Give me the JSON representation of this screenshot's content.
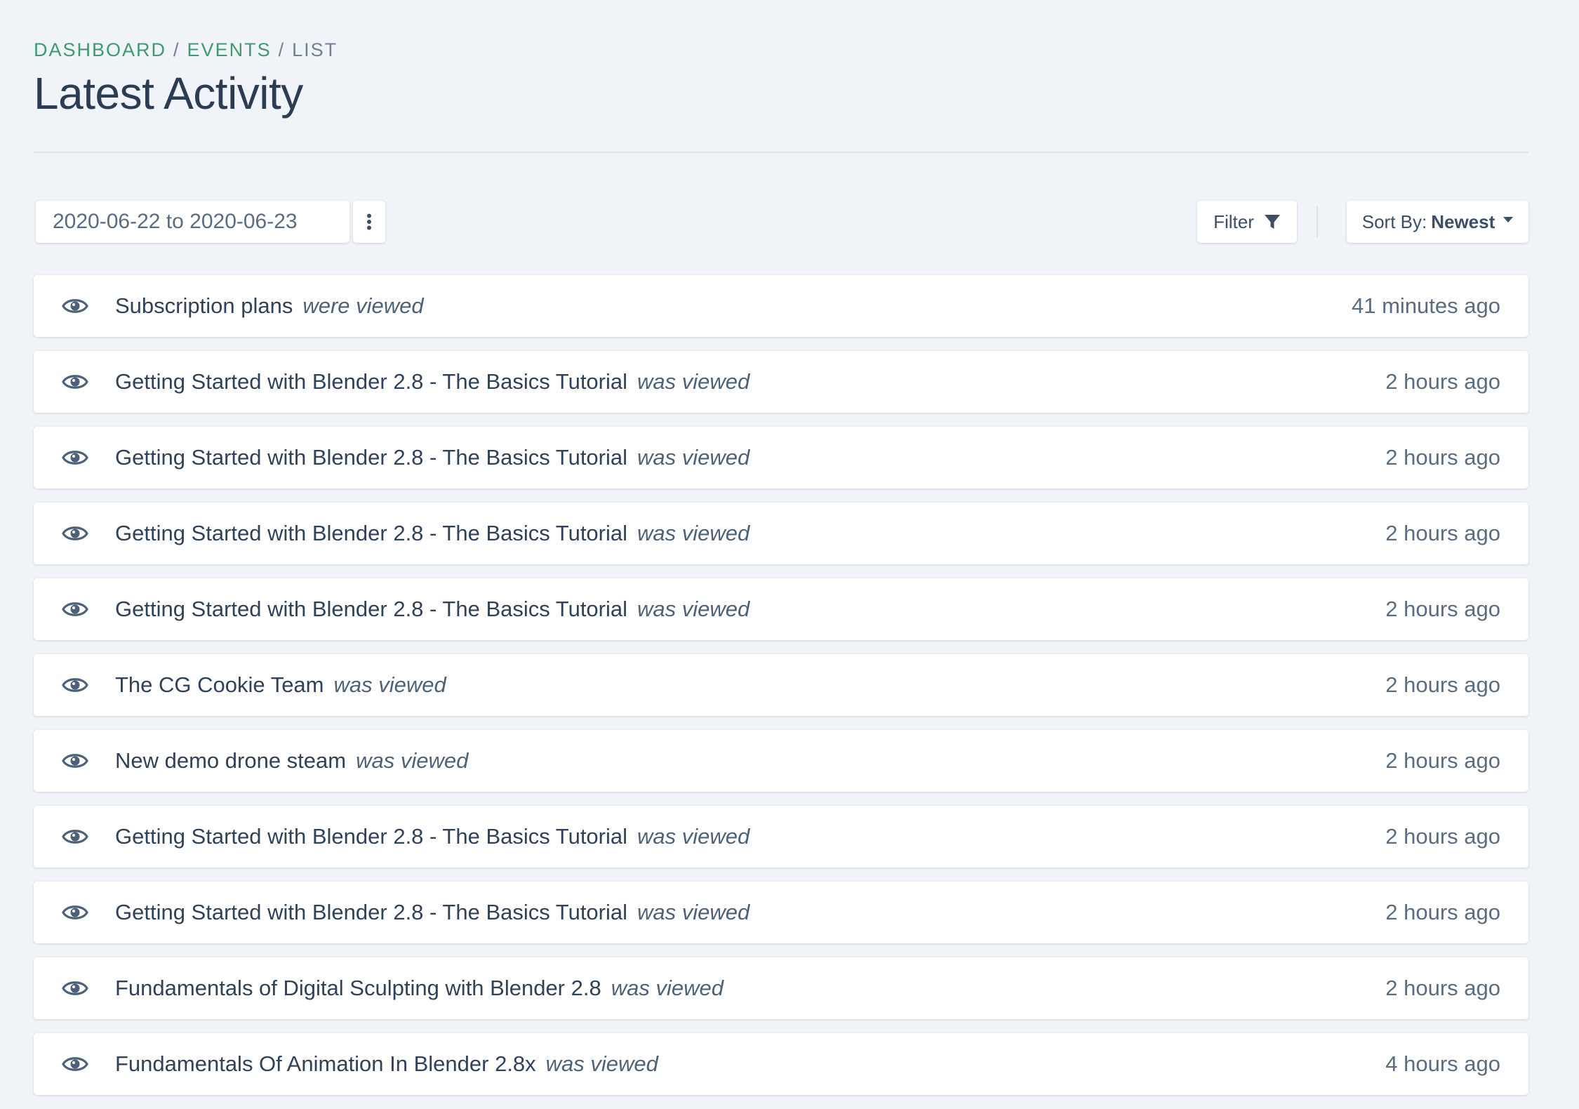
{
  "breadcrumb": {
    "items": [
      {
        "label": "Dashboard"
      },
      {
        "label": "Events"
      },
      {
        "label": "List"
      }
    ],
    "separator": "/"
  },
  "page": {
    "title": "Latest Activity"
  },
  "toolbar": {
    "date_range": "2020-06-22 to 2020-06-23",
    "more_icon": "vertical-ellipsis-icon",
    "filter_label": "Filter",
    "filter_icon": "funnel-icon",
    "sort_prefix": "Sort By:",
    "sort_value": "Newest"
  },
  "colors": {
    "background": "#f0f3f8",
    "link_accent": "#3f9a6f",
    "text_primary": "#2f4259",
    "text_muted": "#5a6c81"
  },
  "activities": [
    {
      "icon": "eye-icon",
      "subject": "Subscription plans",
      "verb": "were viewed",
      "time": "41 minutes ago"
    },
    {
      "icon": "eye-icon",
      "subject": "Getting Started with Blender 2.8 - The Basics Tutorial",
      "verb": "was viewed",
      "time": "2 hours ago"
    },
    {
      "icon": "eye-icon",
      "subject": "Getting Started with Blender 2.8 - The Basics Tutorial",
      "verb": "was viewed",
      "time": "2 hours ago"
    },
    {
      "icon": "eye-icon",
      "subject": "Getting Started with Blender 2.8 - The Basics Tutorial",
      "verb": "was viewed",
      "time": "2 hours ago"
    },
    {
      "icon": "eye-icon",
      "subject": "Getting Started with Blender 2.8 - The Basics Tutorial",
      "verb": "was viewed",
      "time": "2 hours ago"
    },
    {
      "icon": "eye-icon",
      "subject": "The CG Cookie Team",
      "verb": "was viewed",
      "time": "2 hours ago"
    },
    {
      "icon": "eye-icon",
      "subject": "New demo drone steam",
      "verb": "was viewed",
      "time": "2 hours ago"
    },
    {
      "icon": "eye-icon",
      "subject": "Getting Started with Blender 2.8 - The Basics Tutorial",
      "verb": "was viewed",
      "time": "2 hours ago"
    },
    {
      "icon": "eye-icon",
      "subject": "Getting Started with Blender 2.8 - The Basics Tutorial",
      "verb": "was viewed",
      "time": "2 hours ago"
    },
    {
      "icon": "eye-icon",
      "subject": "Fundamentals of Digital Sculpting with Blender 2.8",
      "verb": "was viewed",
      "time": "2 hours ago"
    },
    {
      "icon": "eye-icon",
      "subject": "Fundamentals Of Animation In Blender 2.8x",
      "verb": "was viewed",
      "time": "4 hours ago"
    }
  ]
}
